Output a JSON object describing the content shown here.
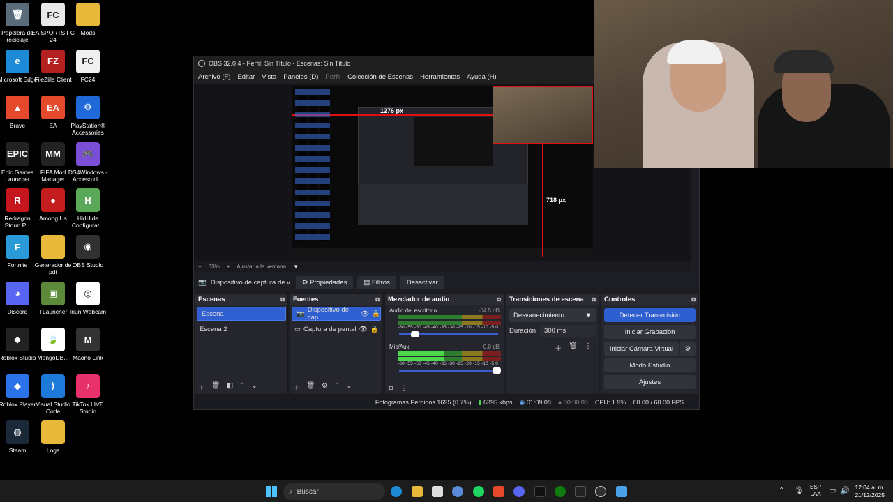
{
  "desktop": {
    "icons": [
      {
        "label": "Papelera de reciclaje",
        "color": "#5a6b7c",
        "glyph": "🗑"
      },
      {
        "label": "EA SPORTS FC 24",
        "color": "#e8e8e8",
        "glyph": "FC"
      },
      {
        "label": "Mods",
        "color": "#e8b83a",
        "glyph": ""
      },
      {
        "label": "Microsoft Edge",
        "color": "#1d8ad8",
        "glyph": "e"
      },
      {
        "label": "FileZilla Client",
        "color": "#b3201f",
        "glyph": "FZ"
      },
      {
        "label": "FC24",
        "color": "#f0f0f0",
        "glyph": "FC"
      },
      {
        "label": "Brave",
        "color": "#e5482b",
        "glyph": "▲"
      },
      {
        "label": "EA",
        "color": "#e54b2a",
        "glyph": "EA"
      },
      {
        "label": "PlayStation® Accessories",
        "color": "#1f6ad8",
        "glyph": "⚙"
      },
      {
        "label": "Epic Games Launcher",
        "color": "#222",
        "glyph": "EPIC"
      },
      {
        "label": "FIFA Mod Manager",
        "color": "#222",
        "glyph": "MM"
      },
      {
        "label": "DS4Windows - Acceso di...",
        "color": "#7b4ed8",
        "glyph": "🎮"
      },
      {
        "label": "Redragon Storm P...",
        "color": "#c4161c",
        "glyph": "R"
      },
      {
        "label": "Among Us",
        "color": "#c41d1d",
        "glyph": "●"
      },
      {
        "label": "HidHide Configurat...",
        "color": "#5aa85a",
        "glyph": "H"
      },
      {
        "label": "Fortnite",
        "color": "#2a9ad8",
        "glyph": "F"
      },
      {
        "label": "Generador de pdf",
        "color": "#e8b83a",
        "glyph": ""
      },
      {
        "label": "OBS Studio",
        "color": "#303030",
        "glyph": "◉"
      },
      {
        "label": "Discord",
        "color": "#5865f2",
        "glyph": "◕"
      },
      {
        "label": "TLauncher",
        "color": "#5a8a3a",
        "glyph": "▣"
      },
      {
        "label": "Iriun Webcam",
        "color": "#fff",
        "glyph": "◎"
      },
      {
        "label": "Roblox Studio",
        "color": "#222",
        "glyph": "◆"
      },
      {
        "label": "MongoDB...",
        "color": "#fff",
        "glyph": "🍃"
      },
      {
        "label": "Maono Link",
        "color": "#333",
        "glyph": "M"
      },
      {
        "label": "Roblox Player",
        "color": "#2b72e8",
        "glyph": "◆"
      },
      {
        "label": "Visual Studio Code",
        "color": "#1d7ad8",
        "glyph": "⟩"
      },
      {
        "label": "TikTok LIVE Studio",
        "color": "#e8306a",
        "glyph": "♪"
      },
      {
        "label": "Steam",
        "color": "#1b2838",
        "glyph": "◍"
      },
      {
        "label": "Logs",
        "color": "#e8b83a",
        "glyph": ""
      }
    ]
  },
  "obs": {
    "title": "OBS 32.0.4 - Perfil: Sin Título - Escenas: Sin Título",
    "menu": [
      "Archivo (F)",
      "Editar",
      "Vista",
      "Paneles (D)",
      "Perfil",
      "Colección de Escenas",
      "Herramientas",
      "Ayuda (H)"
    ],
    "preview": {
      "width_label": "1276 px",
      "height_label": "718 px"
    },
    "zoom": {
      "minus": "−",
      "value": "33%",
      "plus": "+",
      "fit": "Ajustar a la ventana"
    },
    "source_bar": {
      "name": "Dispositivo de captura de v",
      "properties": "Propiedades",
      "filters": "Filtros",
      "deactivate": "Desactivar"
    },
    "scenes": {
      "title": "Escenas",
      "items": [
        "Escena",
        "Escena 2"
      ]
    },
    "sources": {
      "title": "Fuentes",
      "items": [
        "Dispositivo de cap",
        "Captura de pantal"
      ]
    },
    "mixer": {
      "title": "Mezclador de audio",
      "channels": [
        {
          "name": "Audio del escritorio",
          "db": "-64.5 dB",
          "level": 0.28
        },
        {
          "name": "Mic/Aux",
          "db": "0.0 dB",
          "level": 1.0
        }
      ],
      "scale": "-60 -55 -50 -45 -40 -35 -30 -25 -20 -15 -10 -5 0"
    },
    "transitions": {
      "title": "Transiciones de escena",
      "selected": "Desvanecimiento",
      "duration_label": "Duración",
      "duration": "300 ms"
    },
    "controls": {
      "title": "Controles",
      "stop_stream": "Detener Transmisión",
      "start_rec": "Iniciar Grabación",
      "virtual_cam": "Iniciar Cámara Virtual",
      "studio": "Modo Estudio",
      "settings": "Ajustes"
    },
    "status": {
      "dropped": "Fotogramas Perdidos 1695 (0.7%)",
      "bitrate": "6395 kbps",
      "stream_time": "01:09:08",
      "rec_time": "00:00:00",
      "cpu": "CPU: 1.9%",
      "fps": "60.00 / 60.00 FPS"
    }
  },
  "taskbar": {
    "search_placeholder": "Buscar",
    "lang": "ESP",
    "region": "LAA",
    "time": "12:04 a. m.",
    "date": "21/12/2025"
  }
}
